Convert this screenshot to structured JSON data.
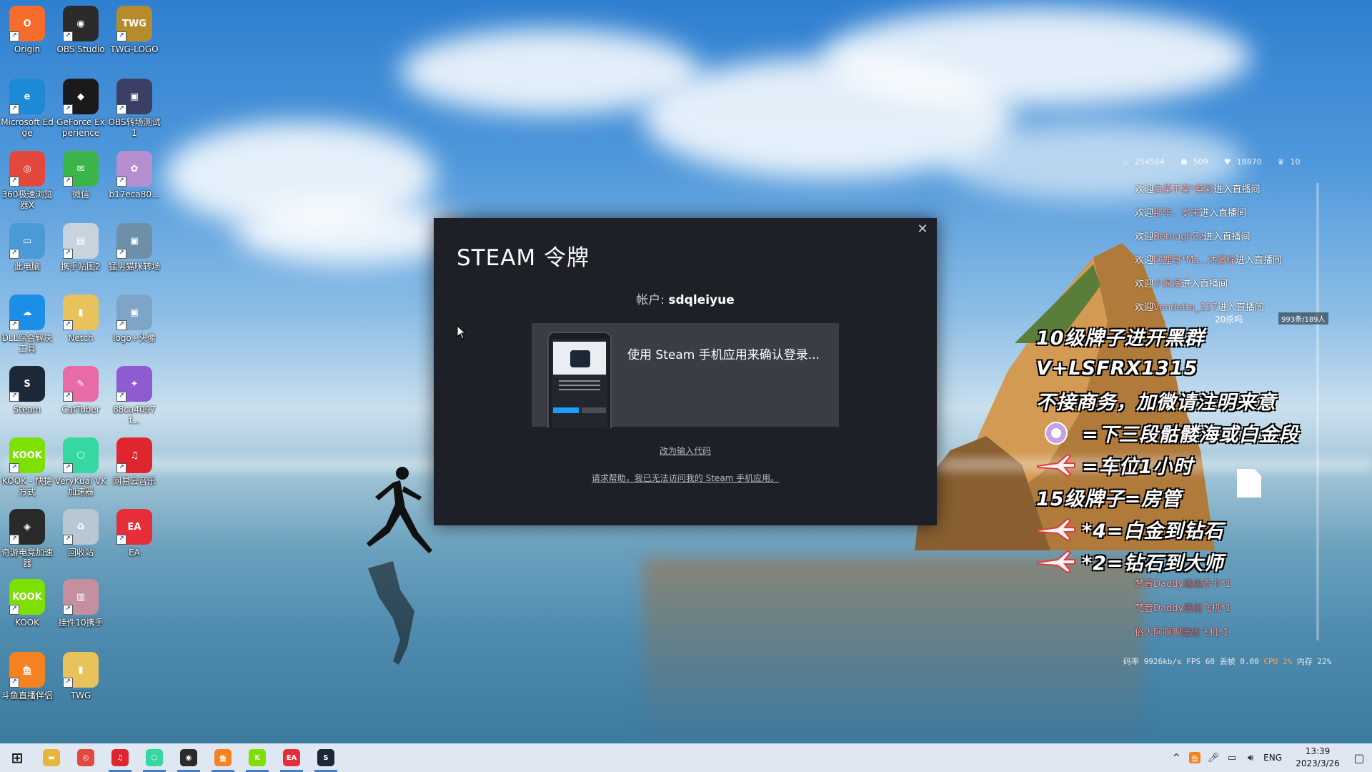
{
  "desktop_icons": [
    {
      "label": "Origin",
      "color": "#f56c2d",
      "glyph": "O"
    },
    {
      "label": "OBS Studio",
      "color": "#2b2b2b",
      "glyph": "◉"
    },
    {
      "label": "TWG-LOGO",
      "color": "#b68b2b",
      "glyph": "TWG"
    },
    {
      "label": "Microsoft Edge",
      "color": "#1c8ad6",
      "glyph": "e"
    },
    {
      "label": "GeForce Experience",
      "color": "#1a1a1a",
      "glyph": "◆"
    },
    {
      "label": "OBS转场测试1",
      "color": "#3a3f63",
      "glyph": "▣"
    },
    {
      "label": "360极速浏览器X",
      "color": "#e2483e",
      "glyph": "◎"
    },
    {
      "label": "微信",
      "color": "#3bb54a",
      "glyph": "✉"
    },
    {
      "label": "b17eca80...",
      "color": "#b68fd1",
      "glyph": "✿"
    },
    {
      "label": "此电脑",
      "color": "#4b9ad8",
      "glyph": "▭"
    },
    {
      "label": "携手贴图2",
      "color": "#c9d3de",
      "glyph": "▤"
    },
    {
      "label": "猛男猫咪转场",
      "color": "#6e8fa8",
      "glyph": "▣"
    },
    {
      "label": "DLL综合解决工具",
      "color": "#1d8ee8",
      "glyph": "☁"
    },
    {
      "label": "Netch",
      "color": "#e8c25a",
      "glyph": "▮"
    },
    {
      "label": "logo+头像",
      "color": "#7ea4c7",
      "glyph": "▣"
    },
    {
      "label": "Steam",
      "color": "#1b2838",
      "glyph": "S"
    },
    {
      "label": "CatTuber",
      "color": "#e86aa6",
      "glyph": "✎"
    },
    {
      "label": "88ca4097f...",
      "color": "#8e5bd0",
      "glyph": "✦"
    },
    {
      "label": "KOOK - 快捷方式",
      "color": "#7ee000",
      "glyph": "KOOK"
    },
    {
      "label": "VeryKuai VK加速器",
      "color": "#36d7a0",
      "glyph": "⬡"
    },
    {
      "label": "网易云音乐",
      "color": "#e0252f",
      "glyph": "♫"
    },
    {
      "label": "奇游电竞加速器",
      "color": "#2a2a2a",
      "glyph": "◈"
    },
    {
      "label": "回收站",
      "color": "#b9c7d5",
      "glyph": "♻"
    },
    {
      "label": "EA",
      "color": "#e62e38",
      "glyph": "EA"
    },
    {
      "label": "KOOK",
      "color": "#7ee000",
      "glyph": "KOOK"
    },
    {
      "label": "挂件10携手",
      "color": "#c48f9f",
      "glyph": "▥"
    },
    {
      "label": "斗鱼直播伴侣",
      "color": "#f58220",
      "glyph": "鱼"
    },
    {
      "label": "TWG",
      "color": "#e8c25a",
      "glyph": "▮"
    }
  ],
  "steam_dialog": {
    "title": "STEAM 令牌",
    "account_label": "帐户:",
    "account_name": "sdqleiyue",
    "confirm_text": "使用 Steam 手机应用来确认登录...",
    "enter_code_link": "改为输入代码",
    "help_link": "请求帮助，我已无法访问我的 Steam 手机应用。",
    "close_glyph": "✕"
  },
  "overlay": {
    "stats": [
      {
        "icon": "flame-icon",
        "glyph": "♨",
        "value": "254564"
      },
      {
        "icon": "users-icon",
        "glyph": "☗",
        "value": "509"
      },
      {
        "icon": "heart-icon",
        "glyph": "♥",
        "value": "18870"
      },
      {
        "icon": "crown-icon",
        "glyph": "♛",
        "value": "10"
      }
    ],
    "chat": [
      {
        "prefix": "欢迎",
        "user": "白菜不菜*蔡彩",
        "suffix": "进入直播间"
      },
      {
        "prefix": "欢迎",
        "user": "那年、岁末",
        "suffix": "进入直播间"
      },
      {
        "prefix": "欢迎",
        "user": "BetoughZz",
        "suffix": "进入直播间"
      },
      {
        "prefix": "欢迎",
        "user": "阿狸哥*Ms...沐藤梓",
        "suffix": "进入直播间"
      },
      {
        "prefix": "欢迎",
        "user": "小浪漫",
        "suffix": "进入直播间"
      },
      {
        "prefix": "欢迎",
        "user": "Vendetta_227",
        "suffix": "进入直播间"
      }
    ],
    "chat_meta": "20杀吗",
    "chat_counter": "993条/189人",
    "promo_lines": [
      "10级牌子进开黑群",
      "V+LSFRX1315",
      "不接商务，加微请注明来意",
      "=下三段骷髅海或白金段",
      "=车位1小时",
      "15级牌子=房管",
      "*4=白金到钻石",
      "*2=钻石到大师"
    ],
    "gifts": [
      {
        "user": "梵音Daddy",
        "verb": "送出",
        "item": "赤卡*1"
      },
      {
        "user": "梵音Daddy",
        "verb": "送出",
        "item": "飞机*1"
      },
      {
        "user": "俗人阿啊啊",
        "verb": "送出",
        "item": "飞机*1"
      }
    ],
    "perf": {
      "text": "码率 9926kb/s FPS 60 丢帧 0.00 ",
      "cpu": "CPU 2%",
      "mem": " 内存 22%"
    }
  },
  "taskbar": {
    "apps": [
      {
        "name": "start-button",
        "glyph": "⊞",
        "color": "#1b1b1b",
        "active": false
      },
      {
        "name": "file-explorer-button",
        "glyph": "▬",
        "color": "#e8b53a",
        "active": false
      },
      {
        "name": "browser-360-button",
        "glyph": "◎",
        "color": "#e2483e",
        "active": false
      },
      {
        "name": "netease-music-button",
        "glyph": "♫",
        "color": "#e0252f",
        "active": true
      },
      {
        "name": "verykuai-button",
        "glyph": "⬡",
        "color": "#36d7a0",
        "active": true
      },
      {
        "name": "obs-button",
        "glyph": "◉",
        "color": "#2b2b2b",
        "active": true
      },
      {
        "name": "douyu-button",
        "glyph": "鱼",
        "color": "#f58220",
        "active": true
      },
      {
        "name": "kook-button",
        "glyph": "K",
        "color": "#7ee000",
        "active": true
      },
      {
        "name": "ea-button",
        "glyph": "EA",
        "color": "#e62e38",
        "active": true
      },
      {
        "name": "steam-button",
        "glyph": "S",
        "color": "#1b2838",
        "active": true
      }
    ],
    "tray": {
      "language": "ENG",
      "time": "13:39",
      "date": "2023/3/26"
    }
  }
}
